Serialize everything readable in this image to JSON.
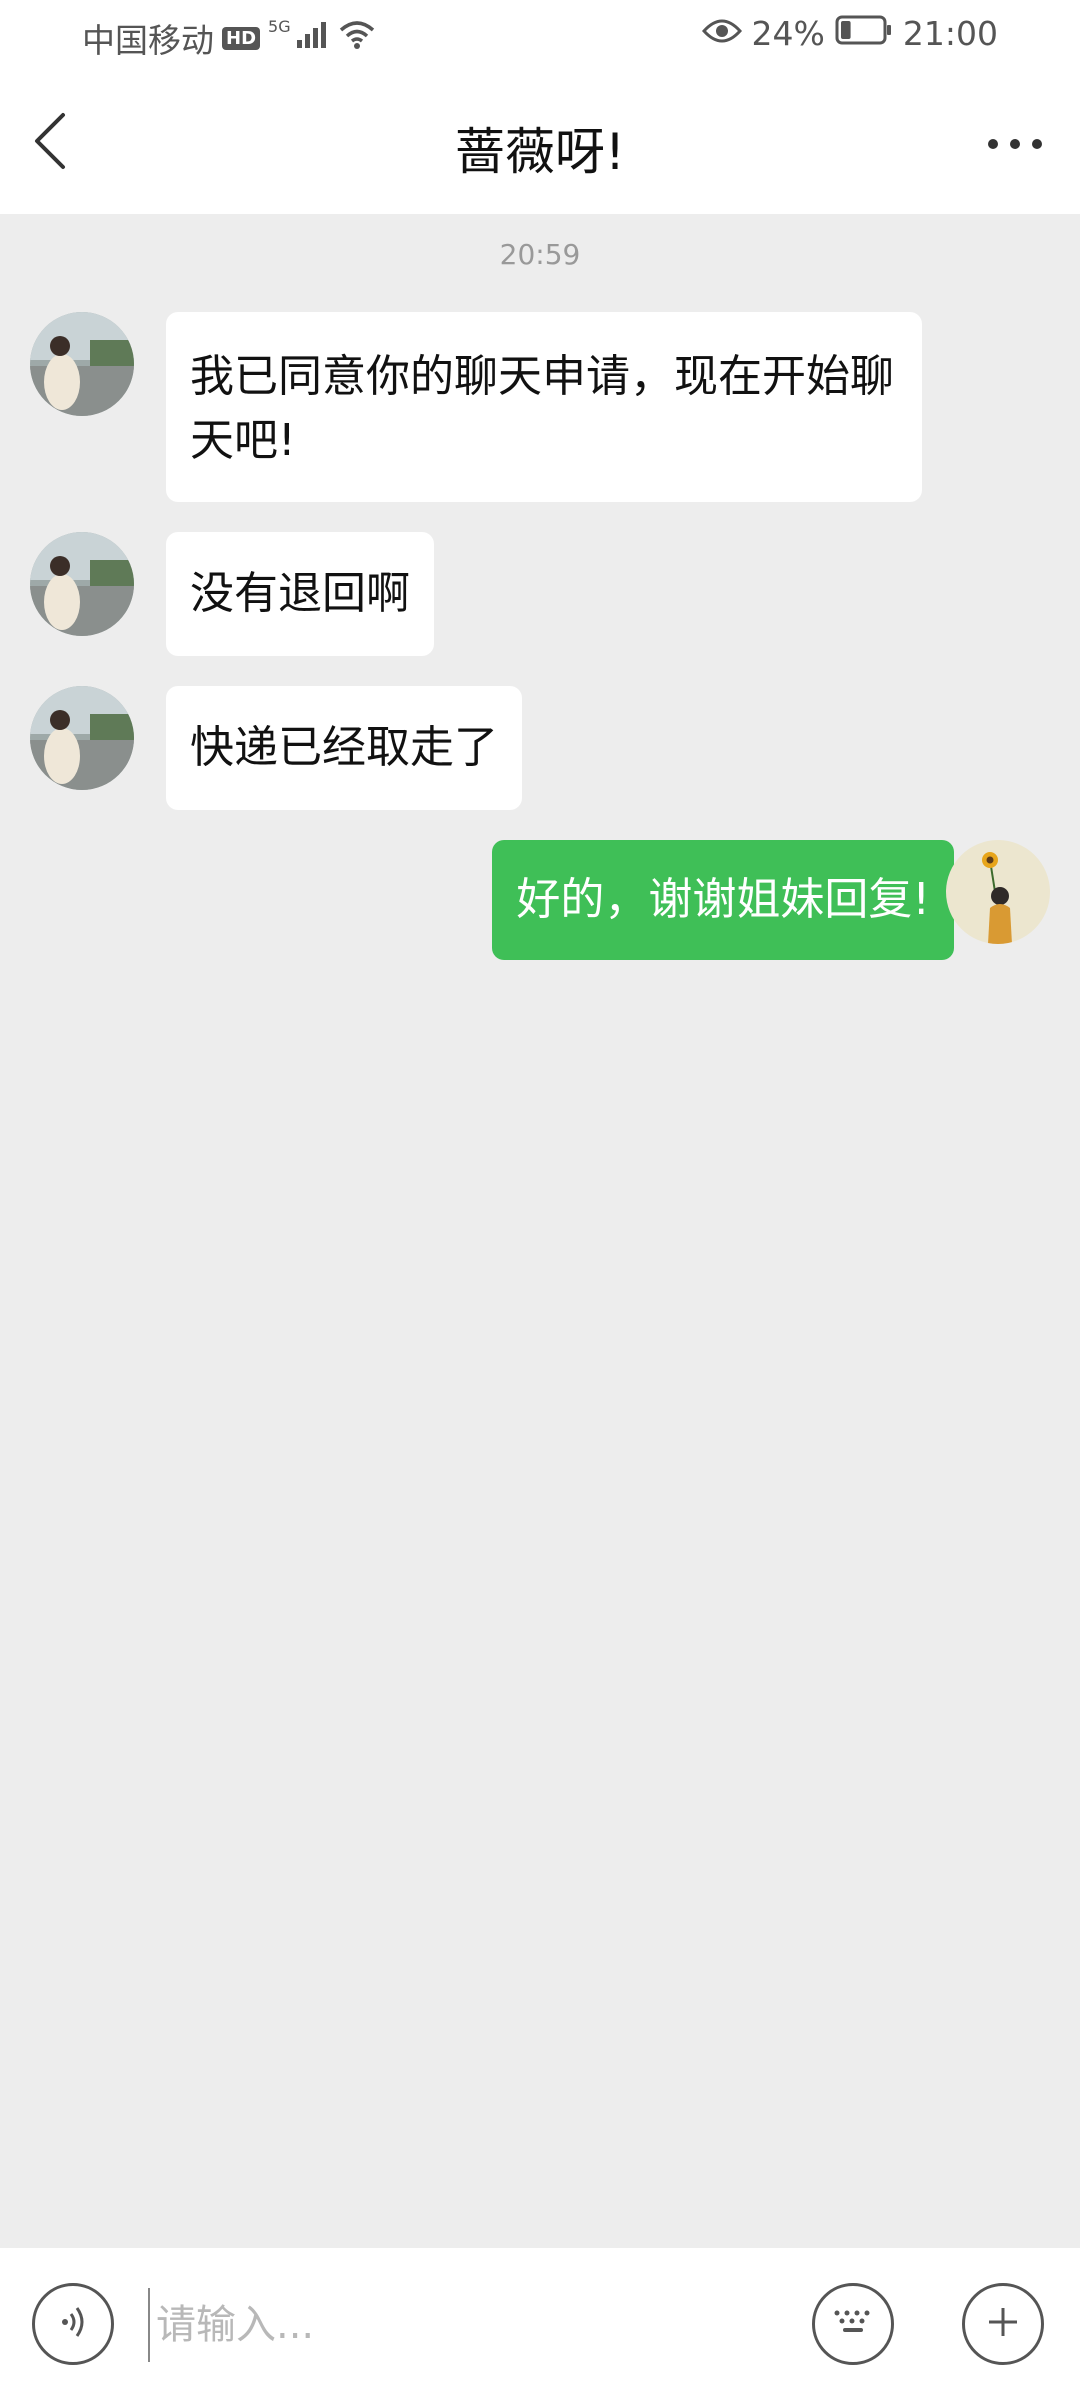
{
  "status_bar": {
    "carrier": "中国移动",
    "hd_badge": "HD",
    "network": "5G",
    "battery": "24%",
    "time": "21:00",
    "battery_level": 0.24,
    "icons": [
      "hd-icon",
      "signal-icon",
      "wifi-icon",
      "eye-icon",
      "battery-icon"
    ]
  },
  "header": {
    "title": "蔷薇呀!",
    "back_icon": "chevron-left-icon",
    "more_icon": "more-dots-icon"
  },
  "chat": {
    "timestamp": "20:59",
    "messages": [
      {
        "direction": "in",
        "text": "我已同意你的聊天申请，现在开始聊天吧!"
      },
      {
        "direction": "in",
        "text": "没有退回啊"
      },
      {
        "direction": "in",
        "text": "快递已经取走了"
      },
      {
        "direction": "out",
        "text": "好的，谢谢姐妹回复!"
      }
    ]
  },
  "input_bar": {
    "placeholder": "请输入...",
    "voice_icon": "voice-icon",
    "keyboard_icon": "keyboard-icon",
    "plus_icon": "plus-icon"
  },
  "colors": {
    "outgoing_bubble": "#3fbf57",
    "incoming_bubble": "#ffffff",
    "chat_background": "#ededed"
  }
}
